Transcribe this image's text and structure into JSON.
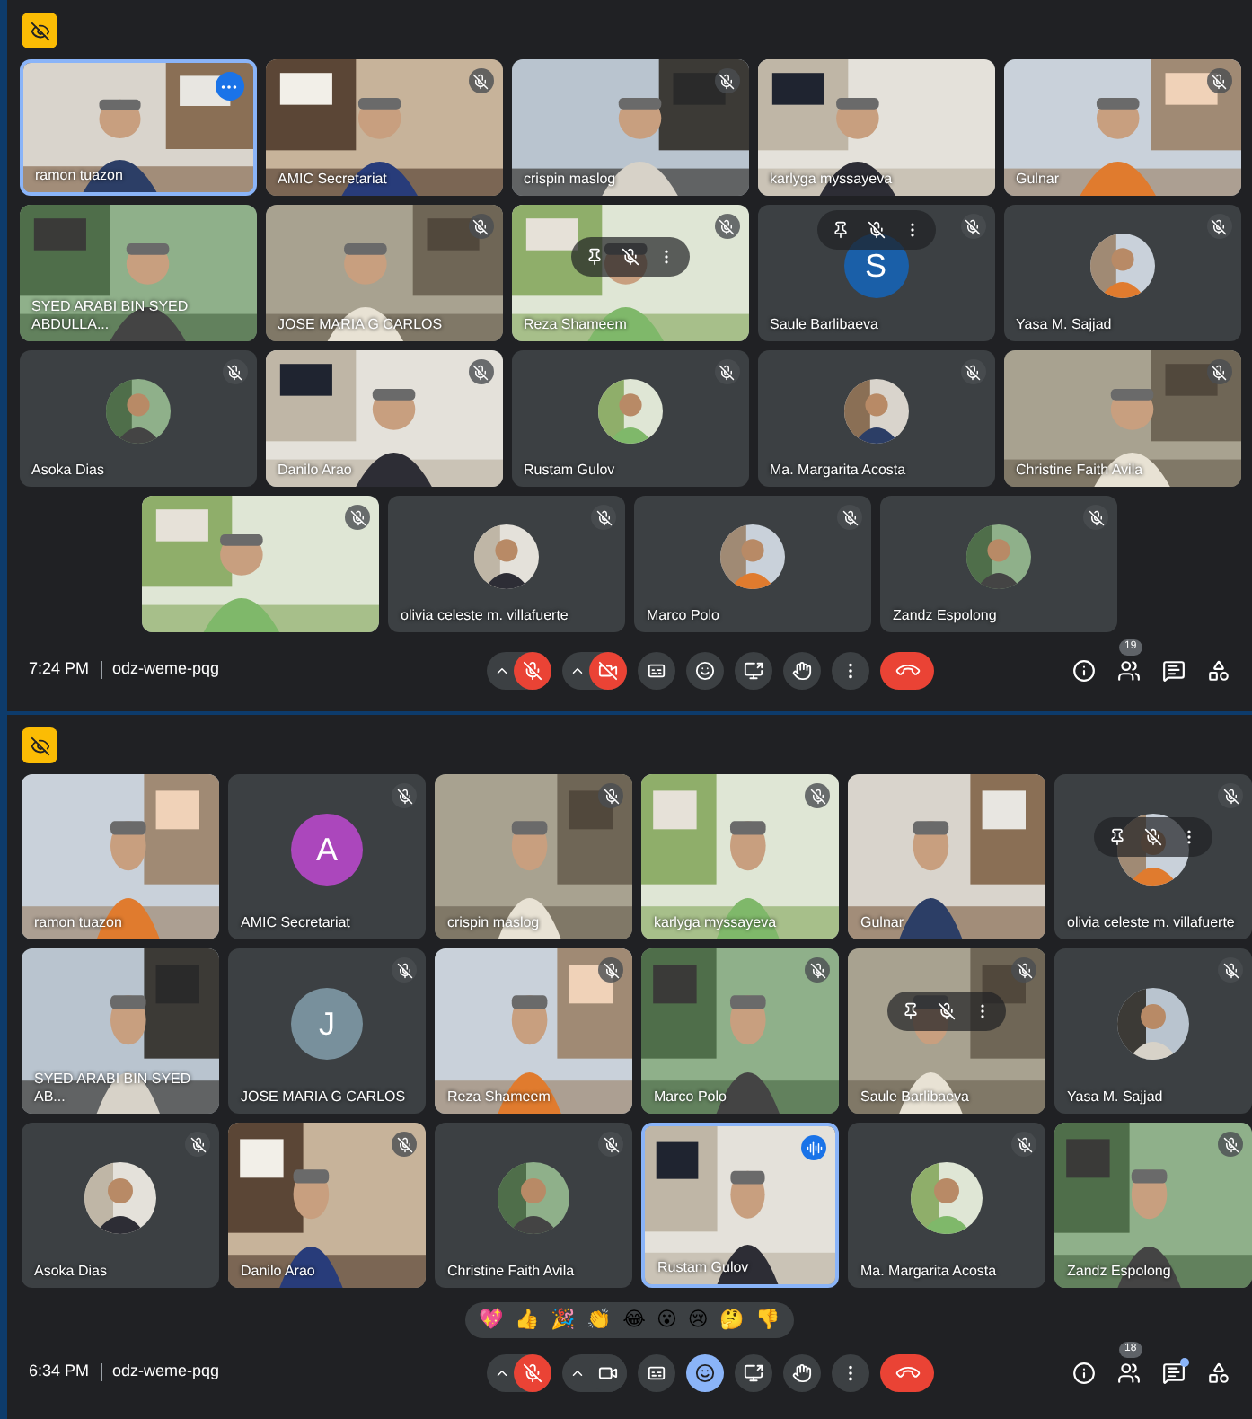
{
  "screens": [
    {
      "rows": [
        [
          {
            "name": "ramon tuazon",
            "kind": "video",
            "muted": false,
            "speaking": true,
            "more_button": true,
            "hover_menu": false
          },
          {
            "name": "AMIC Secretariat",
            "kind": "video",
            "muted": true,
            "speaking": false,
            "hover_menu": false
          },
          {
            "name": "crispin maslog",
            "kind": "video",
            "muted": true,
            "speaking": false,
            "hover_menu": false
          },
          {
            "name": "karlyga myssayeva",
            "kind": "video",
            "muted": false,
            "speaking": false,
            "hover_menu": false
          },
          {
            "name": "Gulnar",
            "kind": "video",
            "muted": true,
            "speaking": false,
            "hover_menu": false
          }
        ],
        [
          {
            "name": "SYED ARABI BIN SYED ABDULLA...",
            "kind": "video",
            "muted": false,
            "speaking": false,
            "hover_menu": false
          },
          {
            "name": "JOSE MARIA G CARLOS",
            "kind": "video",
            "muted": true,
            "speaking": false,
            "hover_menu": false
          },
          {
            "name": "Reza Shameem",
            "kind": "video",
            "muted": true,
            "speaking": false,
            "hover_menu": true
          },
          {
            "name": "Saule Barlibaeva",
            "kind": "letter",
            "letter": "S",
            "color": "#1a5fa8",
            "muted": true,
            "speaking": false,
            "hover_menu": true
          },
          {
            "name": "Yasa M. Sajjad",
            "kind": "avatar",
            "muted": true,
            "speaking": false,
            "hover_menu": false
          }
        ],
        [
          {
            "name": "Asoka Dias",
            "kind": "avatar",
            "muted": true,
            "speaking": false,
            "hover_menu": false
          },
          {
            "name": "Danilo Arao",
            "kind": "video",
            "muted": true,
            "speaking": false,
            "hover_menu": false
          },
          {
            "name": "Rustam Gulov",
            "kind": "avatar",
            "muted": true,
            "speaking": false,
            "hover_menu": false
          },
          {
            "name": "Ma. Margarita Acosta",
            "kind": "avatar",
            "muted": true,
            "speaking": false,
            "hover_menu": false
          },
          {
            "name": "Christine Faith Avila",
            "kind": "video",
            "muted": true,
            "speaking": false,
            "hover_menu": false
          }
        ],
        [
          {
            "kind": "video",
            "muted": true,
            "speaking": false,
            "hover_menu": false
          },
          {
            "name": "olivia celeste m. villafuerte",
            "kind": "avatar",
            "muted": true,
            "speaking": false,
            "hover_menu": false
          },
          {
            "name": "Marco Polo",
            "kind": "avatar",
            "muted": true,
            "speaking": false,
            "hover_menu": false
          },
          {
            "name": "Zandz Espolong",
            "kind": "avatar",
            "muted": true,
            "speaking": false,
            "hover_menu": false
          }
        ]
      ],
      "toolbar": {
        "time": "7:24 PM",
        "code": "odz-weme-pqg",
        "mic_on": false,
        "camera_on": false,
        "reactions_open": false,
        "participant_count": "19",
        "chat_unread": false
      }
    },
    {
      "rows": [
        [
          {
            "name": "ramon tuazon",
            "kind": "video",
            "muted": false,
            "speaking": false,
            "hover_menu": false
          },
          {
            "name": "AMIC Secretariat",
            "kind": "letter",
            "letter": "A",
            "color": "#ab47bc",
            "muted": true,
            "speaking": false,
            "hover_menu": false
          },
          {
            "name": "crispin maslog",
            "kind": "video",
            "muted": true,
            "speaking": false,
            "hover_menu": false
          },
          {
            "name": "karlyga myssayeva",
            "kind": "video",
            "muted": true,
            "speaking": false,
            "hover_menu": false
          },
          {
            "name": "Gulnar",
            "kind": "video",
            "muted": false,
            "speaking": false,
            "hover_menu": false
          },
          {
            "name": "olivia celeste m. villafuerte",
            "kind": "avatar",
            "muted": true,
            "speaking": false,
            "hover_menu": true
          }
        ],
        [
          {
            "name": "SYED ARABI BIN SYED AB...",
            "kind": "video",
            "muted": false,
            "speaking": false,
            "hover_menu": false
          },
          {
            "name": "JOSE MARIA G CARLOS",
            "kind": "letter",
            "letter": "J",
            "color": "#78909c",
            "muted": true,
            "speaking": false,
            "hover_menu": false
          },
          {
            "name": "Reza Shameem",
            "kind": "video",
            "muted": true,
            "speaking": false,
            "hover_menu": false
          },
          {
            "name": "Marco Polo",
            "kind": "video",
            "muted": true,
            "speaking": false,
            "hover_menu": false
          },
          {
            "name": "Saule Barlibaeva",
            "kind": "video",
            "muted": true,
            "speaking": false,
            "hover_menu": true
          },
          {
            "name": "Yasa M. Sajjad",
            "kind": "avatar",
            "muted": true,
            "speaking": false,
            "hover_menu": false
          }
        ],
        [
          {
            "name": "Asoka Dias",
            "kind": "avatar",
            "muted": true,
            "speaking": false,
            "hover_menu": false
          },
          {
            "name": "Danilo Arao",
            "kind": "video",
            "muted": true,
            "speaking": false,
            "hover_menu": false
          },
          {
            "name": "Christine Faith Avila",
            "kind": "avatar",
            "muted": true,
            "speaking": false,
            "hover_menu": false
          },
          {
            "name": "Rustam Gulov",
            "kind": "video",
            "muted": false,
            "speaking": true,
            "more_button": false,
            "hover_menu": false
          },
          {
            "name": "Ma. Margarita Acosta",
            "kind": "avatar",
            "muted": true,
            "speaking": false,
            "hover_menu": false
          },
          {
            "name": "Zandz Espolong",
            "kind": "video",
            "muted": true,
            "speaking": false,
            "hover_menu": false
          }
        ]
      ],
      "reactions": [
        "💖",
        "👍",
        "🎉",
        "👏",
        "😂",
        "😮",
        "😢",
        "🤔",
        "👎"
      ],
      "toolbar": {
        "time": "6:34 PM",
        "code": "odz-weme-pqg",
        "mic_on": false,
        "camera_on": true,
        "reactions_open": true,
        "participant_count": "18",
        "chat_unread": true
      }
    }
  ]
}
